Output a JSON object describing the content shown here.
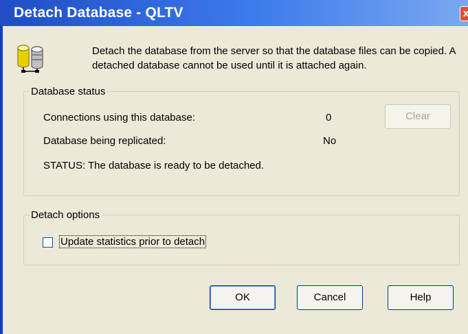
{
  "window": {
    "title": "Detach Database - QLTV",
    "close_glyph": "x"
  },
  "intro_text": "Detach the database from the server so that the database files can be copied. A detached database cannot be used until it is attached again.",
  "status_group": {
    "legend": "Database status",
    "connections_label": "Connections using this database:",
    "connections_value": "0",
    "replicated_label": "Database being replicated:",
    "replicated_value": "No",
    "status_text": "STATUS:  The database is ready to be detached.",
    "clear_button": {
      "label": "Clear",
      "enabled": false
    }
  },
  "options_group": {
    "legend": "Detach options",
    "update_stats_label": "Update statistics prior to detach",
    "update_stats_checked": false
  },
  "buttons": {
    "ok": "OK",
    "cancel": "Cancel",
    "help": "Help"
  },
  "colors": {
    "titlebar": "#3d7bec",
    "dialog_bg": "#ece9d8",
    "close_button": "#e0502e"
  },
  "icons": {
    "dialog_icon": "database-cylinders-icon",
    "close": "close-icon"
  }
}
